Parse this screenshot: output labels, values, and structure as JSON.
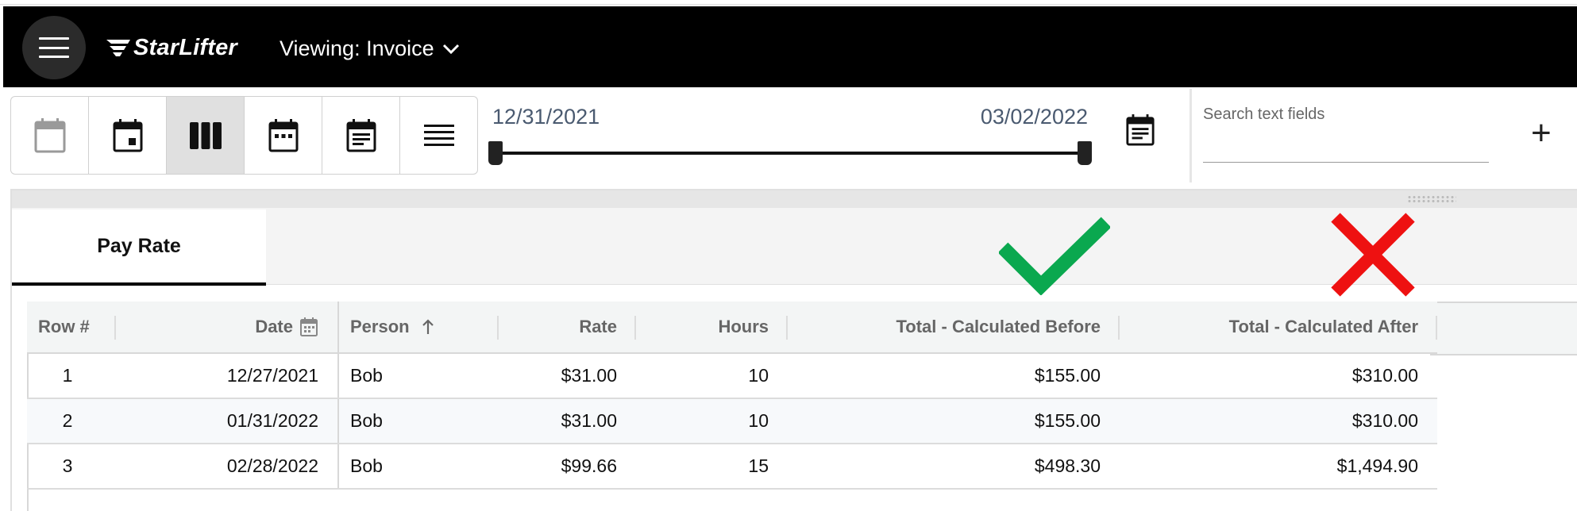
{
  "header": {
    "brand": "StarLifter",
    "viewing_label": "Viewing: Invoice"
  },
  "toolbar": {
    "views": [
      {
        "icon": "calendar-blank-icon",
        "active": false
      },
      {
        "icon": "calendar-day-icon",
        "active": false
      },
      {
        "icon": "columns-icon",
        "active": true
      },
      {
        "icon": "calendar-month-icon",
        "active": false
      },
      {
        "icon": "calendar-notes-icon",
        "active": false
      },
      {
        "icon": "list-lines-icon",
        "active": false
      }
    ],
    "range_start": "12/31/2021",
    "range_end": "03/02/2022",
    "search_placeholder": "Search text fields",
    "add_label": "+"
  },
  "tabs": [
    {
      "label": "Pay Rate",
      "active": true
    }
  ],
  "annotations": {
    "check_color": "#0aa84f",
    "x_color": "#ee1111"
  },
  "table": {
    "columns": [
      "Row #",
      "Date",
      "Person",
      "Rate",
      "Hours",
      "Total - Calculated Before",
      "Total - Calculated After"
    ],
    "rows": [
      {
        "row": "1",
        "date": "12/27/2021",
        "person": "Bob",
        "rate": "$31.00",
        "hours": "10",
        "before": "$155.00",
        "after": "$310.00"
      },
      {
        "row": "2",
        "date": "01/31/2022",
        "person": "Bob",
        "rate": "$31.00",
        "hours": "10",
        "before": "$155.00",
        "after": "$310.00"
      },
      {
        "row": "3",
        "date": "02/28/2022",
        "person": "Bob",
        "rate": "$99.66",
        "hours": "15",
        "before": "$498.30",
        "after": "$1,494.90"
      }
    ]
  }
}
